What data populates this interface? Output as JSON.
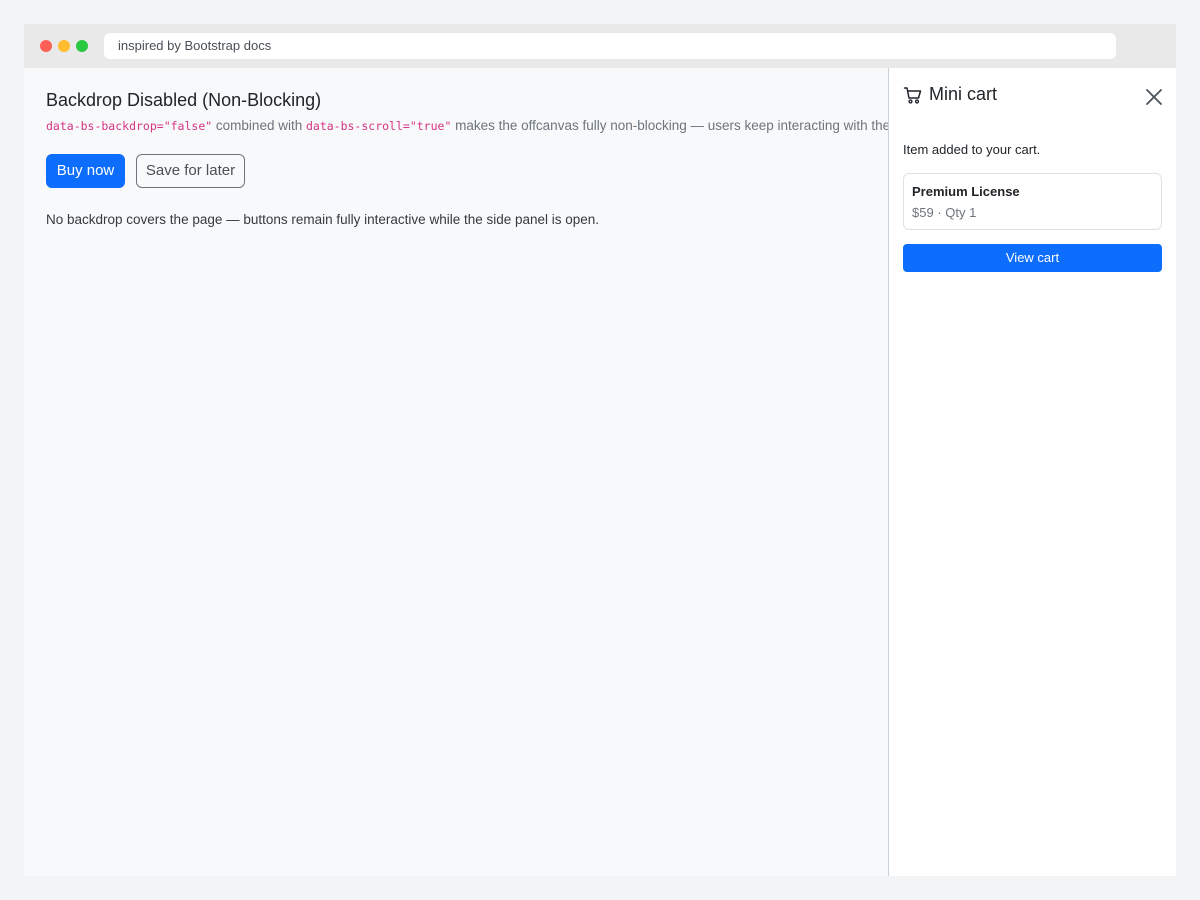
{
  "browser": {
    "address": "inspired by Bootstrap docs"
  },
  "page": {
    "title": "Backdrop Disabled (Non-Blocking)",
    "description": {
      "code1": "data-bs-backdrop=\"false\"",
      "text1": " combined with ",
      "code2": "data-bs-scroll=\"true\"",
      "text2": " makes the offcanvas fully non-blocking — users keep interacting with the page."
    },
    "buttons": {
      "primary": "Buy now",
      "secondary": "Save for later"
    },
    "note": "No backdrop covers the page — buttons remain fully interactive while the side panel is open."
  },
  "offcanvas": {
    "title": "Mini cart",
    "icon": "cart-icon",
    "close_icon": "close-icon",
    "message": "Item added to your cart.",
    "item": {
      "name": "Premium License",
      "meta": "$59 · Qty 1"
    },
    "action": "View cart"
  },
  "colors": {
    "primary": "#0d6efd",
    "code": "#d63384",
    "muted": "#6c757d"
  }
}
